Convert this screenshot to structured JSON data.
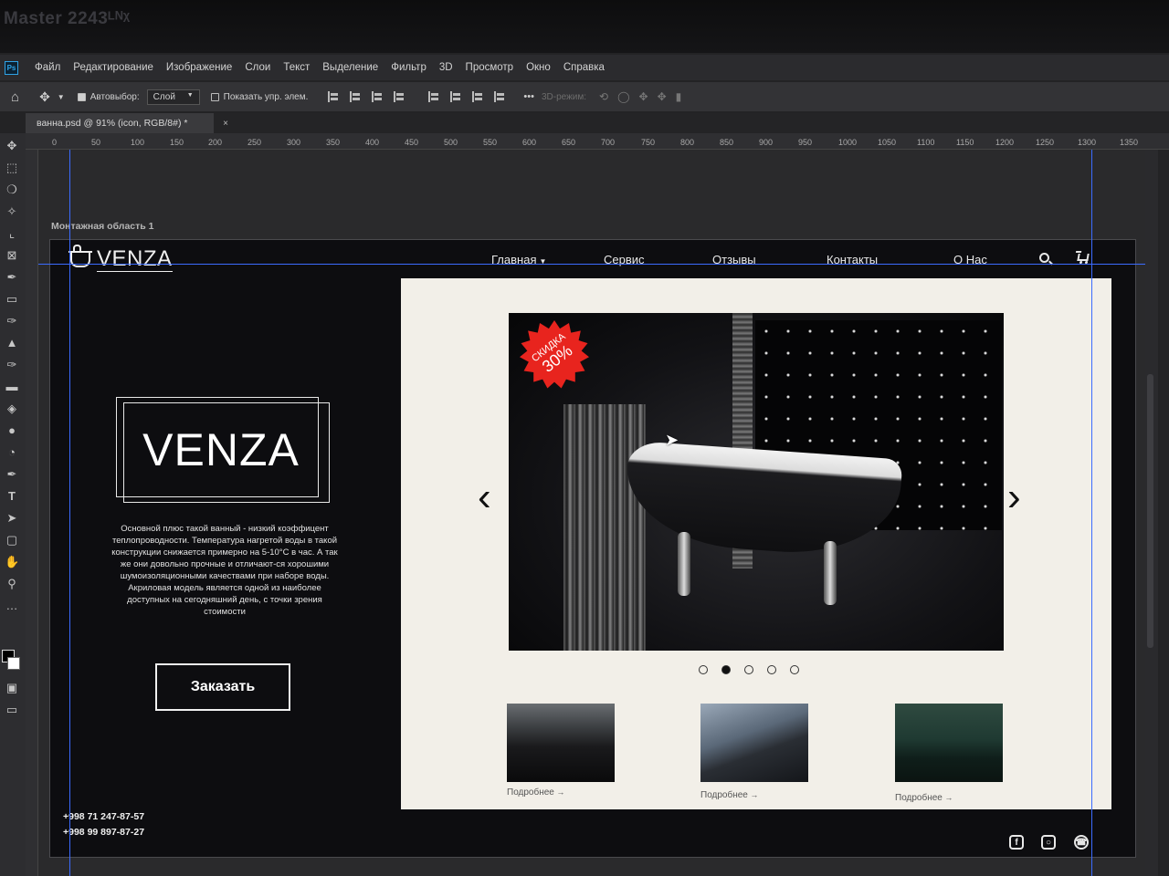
{
  "monitor": {
    "label": "Master 2243ᴸᴺᵡ"
  },
  "app": {
    "logo": "Ps"
  },
  "menu": [
    "Файл",
    "Редактирование",
    "Изображение",
    "Слои",
    "Текст",
    "Выделение",
    "Фильтр",
    "3D",
    "Просмотр",
    "Окно",
    "Справка"
  ],
  "options": {
    "autoselect_label": "Автовыбор:",
    "autoselect_value": "Слой",
    "show_transform_label": "Показать упр. элем.",
    "mode_3d_label": "3D-режим:",
    "more_label": "•••"
  },
  "document": {
    "tab_title": "ванна.psd @ 91% (icon, RGB/8#) *",
    "close": "×",
    "artboard_label": "Монтажная область 1"
  },
  "ruler": {
    "ticks": [
      "0",
      "50",
      "100",
      "150",
      "200",
      "250",
      "300",
      "350",
      "400",
      "450",
      "500",
      "550",
      "600",
      "650",
      "700",
      "750",
      "800",
      "850",
      "900",
      "950",
      "1000",
      "1050",
      "1100",
      "1150",
      "1200",
      "1250",
      "1300",
      "1350"
    ]
  },
  "site": {
    "logo": "VENZA",
    "nav": [
      "Главная",
      "Сервис",
      "Отзывы",
      "Контакты",
      "О Нас"
    ],
    "hero_title": "VENZA",
    "hero_text": "Основной плюс  такой ванный - низкий коэффицент теплопроводности. Температура нагретой воды в такой конструкции снижается примерно на 5-10°С в час. А так же они довольно прочные и отличают-ся хорошими шумоизоляционными качествами при наборе воды. Акриловая модель является одной из наиболее доступных на сегодняшний день, с точки зрения стоимости",
    "order_button": "Заказать",
    "phones": [
      "+998 71 247-87-57",
      "+998 99 897-87-27"
    ],
    "badge": {
      "line1": "СКИДКА",
      "line2": "30%"
    },
    "slider": {
      "prev": "‹",
      "next": "›",
      "dots": 5,
      "active_dot": 2
    },
    "thumb_links": [
      "Подробнее",
      "Подробнее",
      "Подробнее"
    ],
    "social": [
      "facebook-icon",
      "instagram-icon",
      "whatsapp-icon"
    ],
    "colors": {
      "background": "#0d0d10",
      "panel": "#f2efe8",
      "badge": "#e8241e",
      "guide": "#3b6bff"
    }
  }
}
